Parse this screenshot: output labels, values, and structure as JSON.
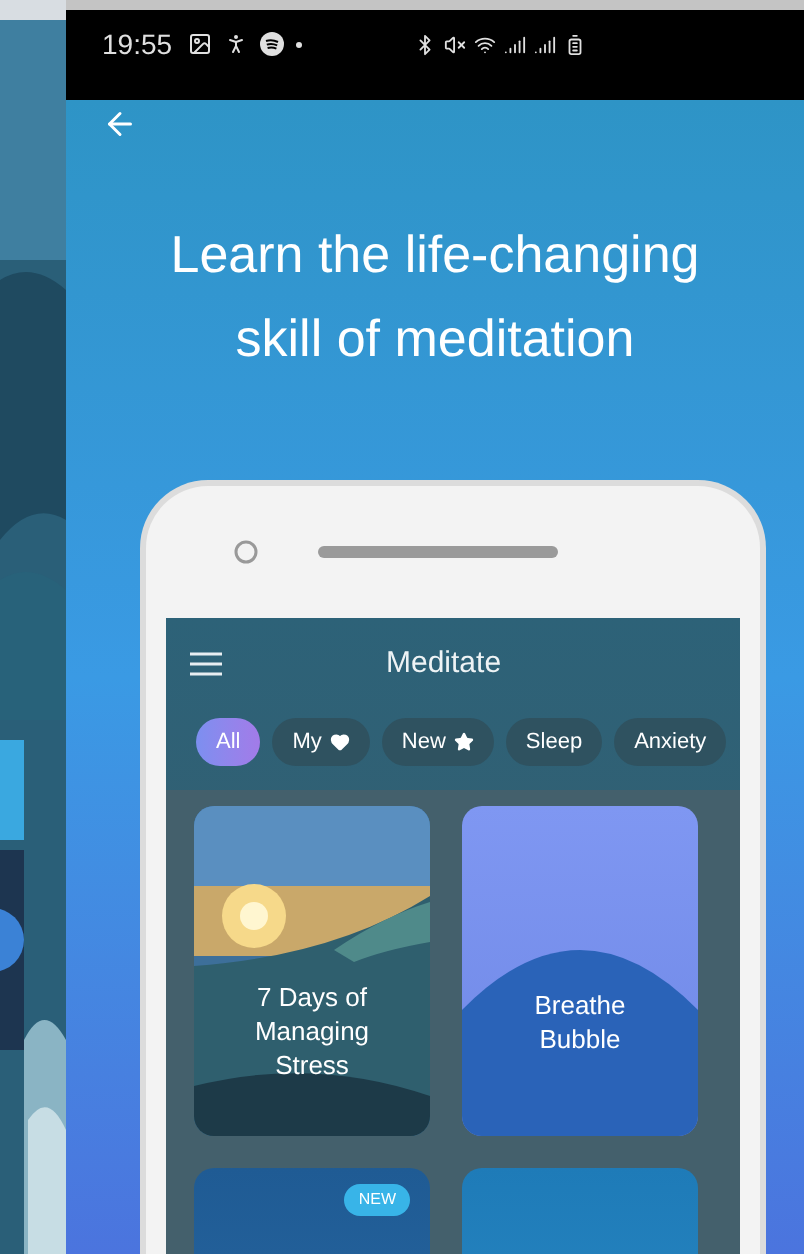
{
  "status_bar": {
    "time": "19:55"
  },
  "headline": "Learn the life-changing skill of meditation",
  "app": {
    "title": "Meditate",
    "filters": [
      {
        "label": "All",
        "kind": "plain",
        "selected": true
      },
      {
        "label": "My",
        "kind": "heart",
        "selected": false
      },
      {
        "label": "New",
        "kind": "star",
        "selected": false
      },
      {
        "label": "Sleep",
        "kind": "plain",
        "selected": false
      },
      {
        "label": "Anxiety",
        "kind": "plain",
        "selected": false
      }
    ],
    "cards": [
      {
        "title": "7 Days of Managing Stress"
      },
      {
        "kind": "bubble",
        "title": "Breathe Bubble"
      },
      {
        "kind": "plain",
        "badge": "NEW"
      },
      {
        "kind": "ocean"
      }
    ]
  }
}
